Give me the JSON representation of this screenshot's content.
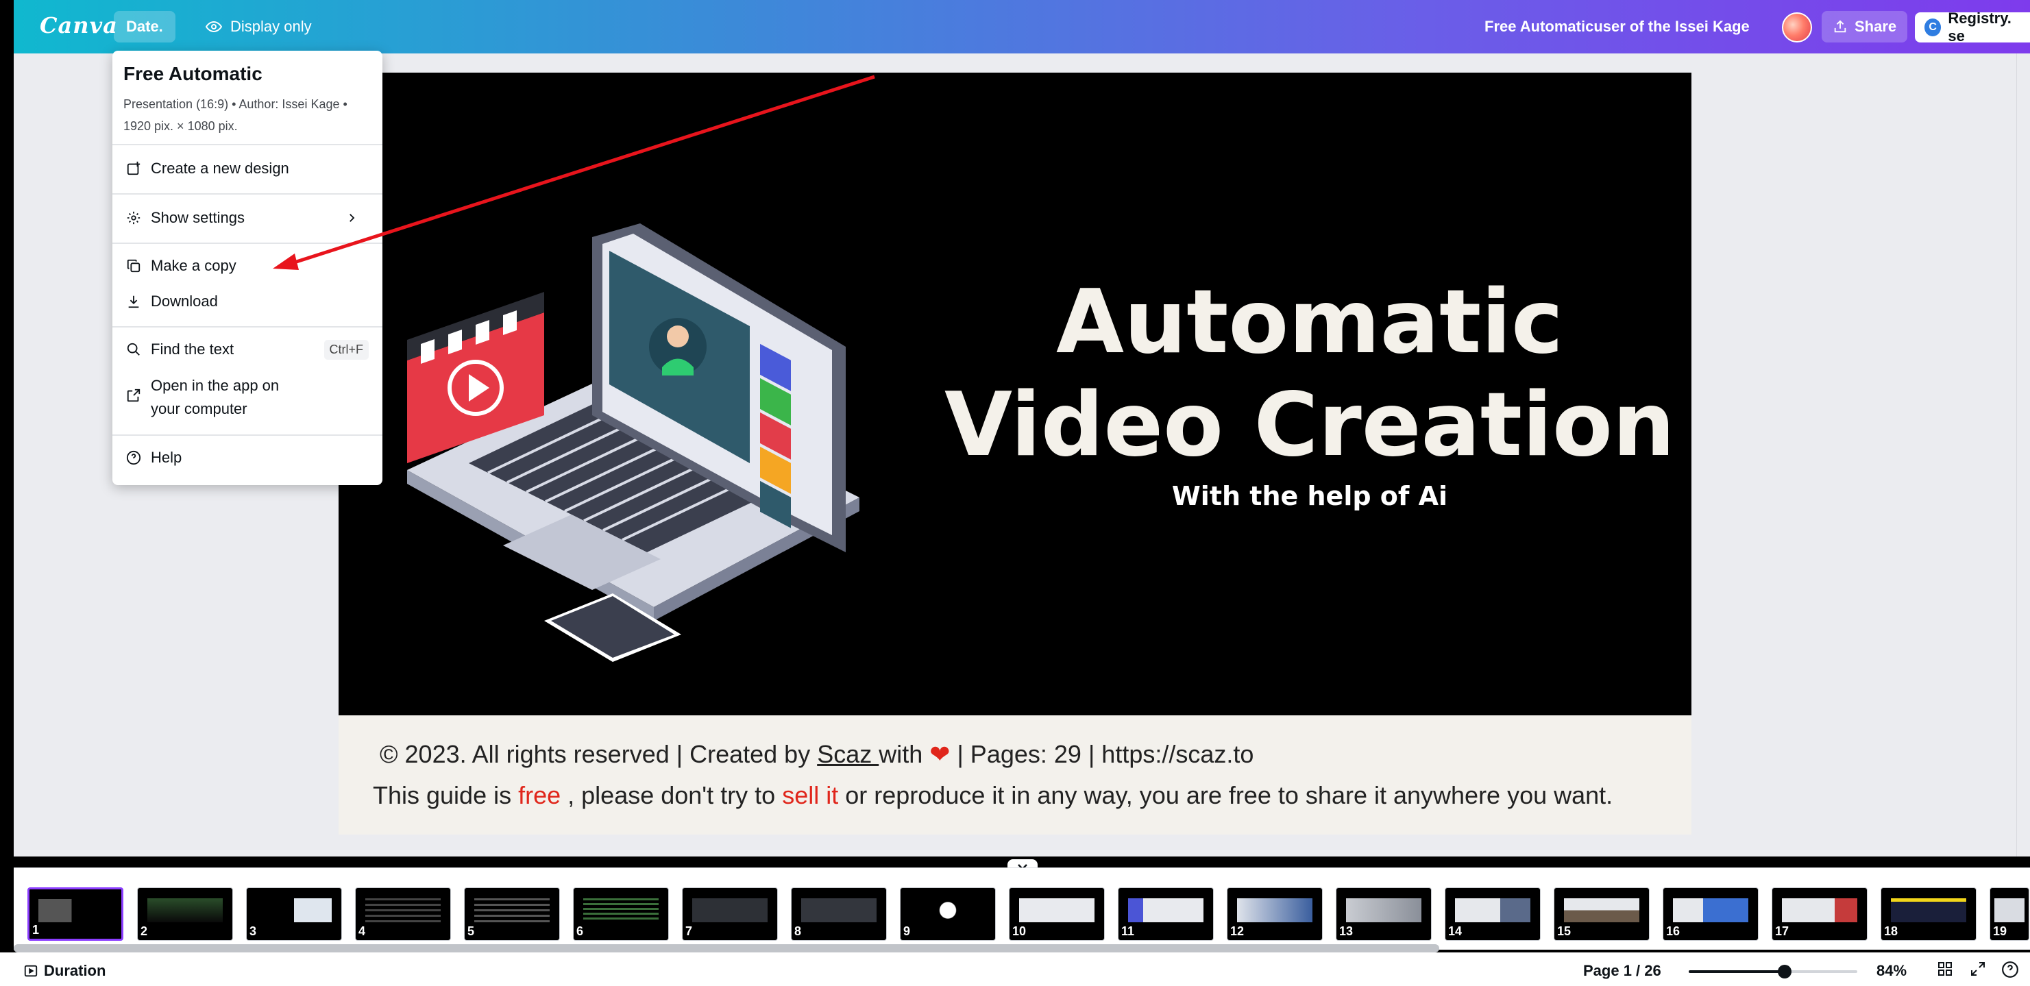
{
  "app": {
    "logo": "Canva",
    "file_menu_label": "Date.",
    "display_label": "Display only",
    "document_title": "Free Automaticuser of the Issei Kage",
    "share_label": "Share",
    "account_label": "Registry. se"
  },
  "menu": {
    "title": "Free Automatic",
    "meta_line1": "Presentation (16:9) • Author: Issei Kage •",
    "meta_line2": "1920 pix. × 1080 pix.",
    "items": [
      {
        "label": "Create a new design",
        "icon": "plus-square-icon"
      },
      {
        "label": "Show settings",
        "icon": "gear-icon"
      },
      {
        "label": "Make a copy",
        "icon": "copy-icon"
      },
      {
        "label": "Download",
        "icon": "download-icon"
      },
      {
        "label": "Find the text",
        "icon": "search-icon",
        "shortcut": "Ctrl+F"
      },
      {
        "label_line1": "Open in the app on",
        "label_line2": "your computer",
        "icon": "external-link-icon"
      },
      {
        "label": "Help",
        "icon": "help-icon"
      }
    ]
  },
  "slide": {
    "title_line1": "Automatic",
    "title_line2": "Video Creation",
    "subtitle": "With the help of Ai",
    "footer_line1_a": "© 2023. All rights reserved | Created by ",
    "footer_line1_link": "Scaz ",
    "footer_line1_b": "with ",
    "footer_line1_c": " | Pages: ",
    "footer_pages": "29",
    "footer_line1_d": " | https://scaz.to",
    "footer_line2_a": "This guide is ",
    "footer_line2_free": "free ",
    "footer_line2_b": ", please don't try to ",
    "footer_line2_sell": "sell it",
    "footer_line2_c": " or reproduce it in any way, you are free to share it anywhere you want."
  },
  "filmstrip": {
    "thumbnails": [
      "1",
      "2",
      "3",
      "4",
      "5",
      "6",
      "7",
      "8",
      "9",
      "10",
      "11",
      "12",
      "13",
      "14",
      "15",
      "16",
      "17",
      "18",
      "19"
    ],
    "selected": "1"
  },
  "status": {
    "duration_label": "Duration",
    "page_indicator": "Page 1 / 26",
    "zoom_label": "84%",
    "zoom_fraction": 0.57
  },
  "colors": {
    "accent": "#8b3dff",
    "red_text": "#e0261b",
    "annotation_arrow": "#e8141c"
  }
}
